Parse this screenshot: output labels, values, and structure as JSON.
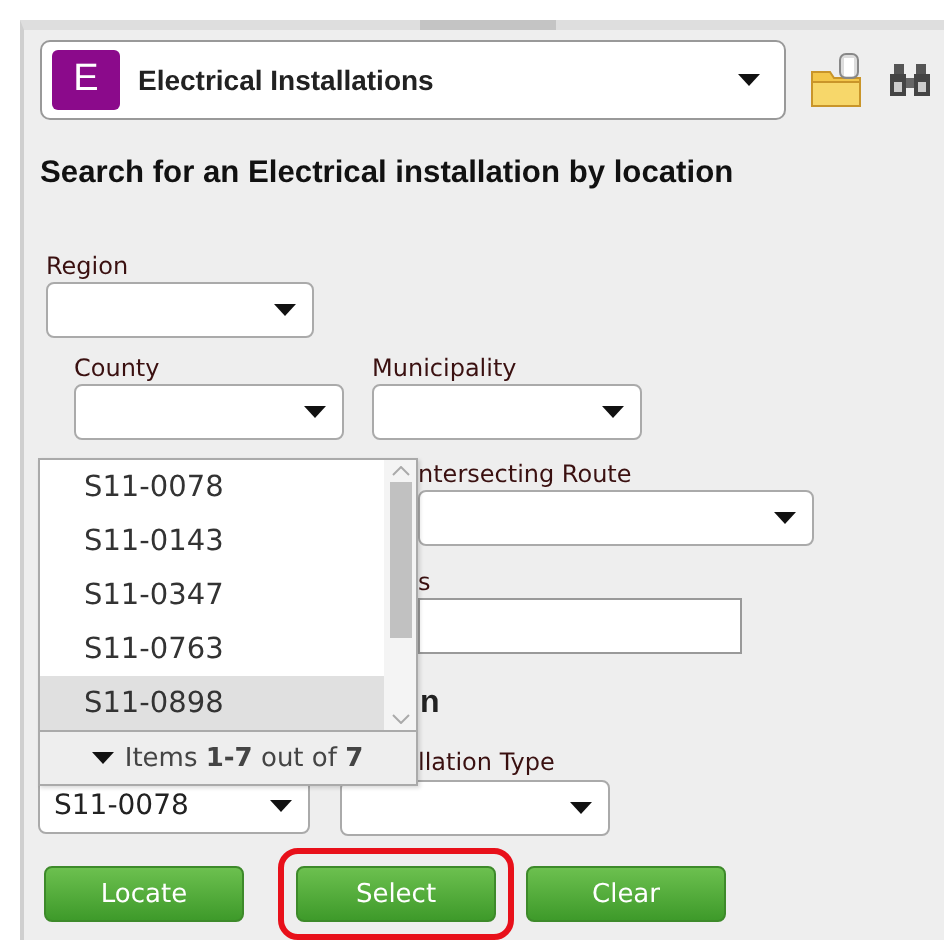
{
  "layer_select": {
    "badge": "E",
    "label": "Electrical Installations"
  },
  "heading": "Search for an Electrical installation by location",
  "region": {
    "label": "Region"
  },
  "county": {
    "label": "County"
  },
  "municipality": {
    "label": "Municipality"
  },
  "intersecting_route": {
    "label": "ntersecting Route"
  },
  "field_2": {
    "label": "s"
  },
  "subheading": "n",
  "installation_type": {
    "label": "llation Type"
  },
  "route_combo": {
    "value": "S11-0078"
  },
  "dropdown": {
    "items": [
      {
        "label": "S11-0078",
        "selected": false
      },
      {
        "label": "S11-0143",
        "selected": false
      },
      {
        "label": "S11-0347",
        "selected": false
      },
      {
        "label": "S11-0763",
        "selected": false
      },
      {
        "label": "S11-0898",
        "selected": true
      }
    ],
    "footer": "Items **1-7** out of **7**"
  },
  "buttons": [
    {
      "label": "Locate",
      "highlighted": false
    },
    {
      "label": "Select",
      "highlighted": true
    },
    {
      "label": "Clear",
      "highlighted": false
    }
  ]
}
